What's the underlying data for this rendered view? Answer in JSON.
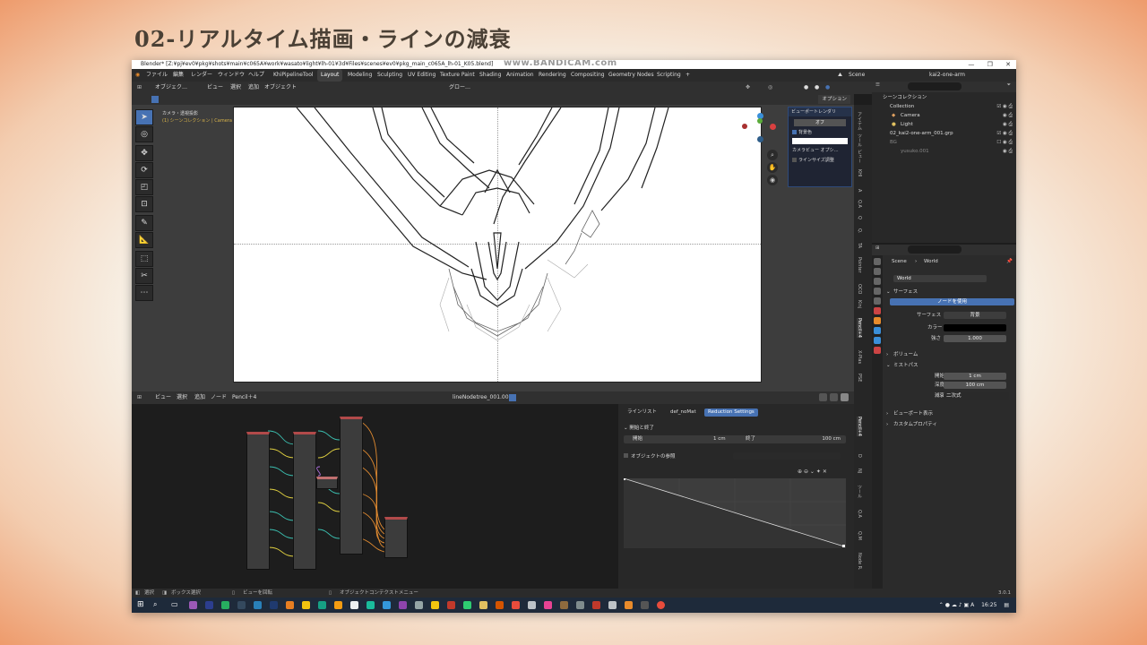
{
  "slide_title": "02-リアルタイム描画・ラインの減衰",
  "window_title": "Blender* [Z:¥pj¥ev0¥pkg¥shots¥main¥c065A¥work¥wasato¥light¥lh-01¥3d¥Files¥scenes¥ev0¥pkg_main_c065A_lh-01_K05.blend]",
  "bandicam": "www.BANDICAM.com",
  "window_controls": {
    "min": "—",
    "max": "❐",
    "close": "✕"
  },
  "menu": [
    "ファイル",
    "編集",
    "レンダー",
    "ウィンドウ",
    "ヘルプ",
    "KhiPipelineTool"
  ],
  "workspaces": [
    "Layout",
    "Modeling",
    "Sculpting",
    "UV Editing",
    "Texture Paint",
    "Shading",
    "Animation",
    "Rendering",
    "Compositing",
    "Geometry Nodes",
    "Scripting",
    "+"
  ],
  "active_workspace": "Layout",
  "scene_name": "Scene",
  "view_layer": "kai2-one-arm",
  "toolbar": {
    "mode": "オブジェク…",
    "view": "ビュー",
    "select": "選択",
    "add": "追加",
    "object": "オブジェクト",
    "global": "グロー…",
    "options": "オプション"
  },
  "viewport": {
    "camera_label": "カメラ・透視投影",
    "collection_label": "(1) シーンコレクション | Camera"
  },
  "npanel": {
    "header": "ビューポートレンダリ",
    "button": "オフ",
    "bg_color_label": "背景色",
    "camera_view_label": "カメラビュー オプシ…",
    "line_size_label": "ラインサイズ調整"
  },
  "npanel_tabs": [
    "アイテム",
    "ツール",
    "ビュー",
    "KHI",
    "A",
    "Q.A",
    "Q",
    "Q.",
    "TA",
    "Pointer",
    "OCO",
    "Kinj",
    "Pencil+4",
    "X-Plas",
    "PSE",
    "Pencil+4",
    "D",
    "NJ",
    "ツール",
    "Q.A",
    "Q.M",
    "Node R."
  ],
  "outliner": {
    "title": "シーンコレクション",
    "rows": [
      {
        "label": "Collection",
        "indent": 1,
        "color": "#ffffff"
      },
      {
        "label": "Camera",
        "indent": 2,
        "color": "#e0a060"
      },
      {
        "label": "Light",
        "indent": 2,
        "color": "#e0c060"
      },
      {
        "label": "02_kai2-one-arm_001.grp",
        "indent": 1,
        "color": "#ffffff"
      },
      {
        "label": "BG",
        "indent": 1,
        "color": "#888888"
      },
      {
        "label": "yusuko.001",
        "indent": 2,
        "color": "#888888"
      }
    ]
  },
  "properties": {
    "breadcrumb_scene": "Scene",
    "breadcrumb_world": "World",
    "world_name": "World",
    "surface_section": "サーフェス",
    "use_nodes": "ノードを使用",
    "surface_label": "サーフェス",
    "surface_value": "背景",
    "color_label": "カラー",
    "strength_label": "強さ",
    "strength_value": "1.000",
    "volume_section": "ボリューム",
    "mist_section": "ミストパス",
    "start_label": "開始",
    "start_value": "1 cm",
    "depth_label": "深度",
    "depth_value": "100 cm",
    "falloff_label": "減衰",
    "falloff_value": "二次式",
    "viewport_display": "ビューポート表示",
    "custom_props": "カスタムプロパティ"
  },
  "node_editor": {
    "view": "ビュー",
    "select": "選択",
    "add": "追加",
    "node": "ノード",
    "pencil": "Pencil＋4",
    "tree_name": "lineNodetree_001.001"
  },
  "reduction": {
    "tabs": [
      "ラインリスト",
      "def_noMat",
      "Reduction Settings"
    ],
    "active_tab": "Reduction Settings",
    "section_start_end": "開始と終了",
    "start_label": "開始",
    "start_value": "1 cm",
    "end_label": "終了",
    "end_value": "100 cm",
    "object_ref": "オブジェクトの参照"
  },
  "statusbar": {
    "select": "選択",
    "box_select": "ボックス選択",
    "rotate_view": "ビューを回転",
    "context_menu": "オブジェクトコンテクストメニュー",
    "version": "3.0.1"
  },
  "taskbar": {
    "time": "16:25",
    "lang": "A"
  }
}
